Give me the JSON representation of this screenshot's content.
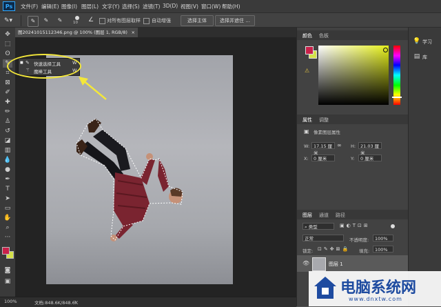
{
  "app": {
    "logo": "Ps"
  },
  "menu": [
    "文件(F)",
    "编辑(E)",
    "图像(I)",
    "图层(L)",
    "文字(Y)",
    "选择(S)",
    "滤镜(T)",
    "3D(D)",
    "视图(V)",
    "窗口(W)",
    "帮助(H)"
  ],
  "options_bar": {
    "brush_size": "10",
    "sample_all_layers": "对所有图层取样",
    "auto_enhance": "自动增强",
    "select_subject": "选择主体",
    "select_and_mask": "选择并遮住 ..."
  },
  "document": {
    "tab_title": "图20241015112346.png @ 100% (图层 1, RGB/8)",
    "close": "×"
  },
  "flyout": {
    "items": [
      {
        "label": "快速选择工具",
        "shortcut": "W"
      },
      {
        "label": "魔棒工具",
        "shortcut": "W"
      }
    ]
  },
  "status": {
    "zoom": "100%",
    "doc_info": "文档:848.6K/848.6K",
    "arrow": "›"
  },
  "color_panel": {
    "tabs": [
      "颜色",
      "色板"
    ],
    "foreground": "#c8214a",
    "background": "#d4e04a",
    "hue_color": "#e6f01a"
  },
  "properties_panel": {
    "tabs": [
      "属性",
      "调整"
    ],
    "title": "像素图层属性",
    "w_label": "W:",
    "w_value": "17.15 厘米",
    "h_label": "H:",
    "h_value": "21.03 厘米",
    "x_label": "X:",
    "x_value": "0 厘米",
    "y_label": "Y:",
    "y_value": "0 厘米"
  },
  "layers_panel": {
    "tabs": [
      "图层",
      "通道",
      "路径"
    ],
    "filter": "类型",
    "blend_mode": "正常",
    "opacity_label": "不透明度:",
    "opacity_value": "100%",
    "lock_label": "锁定:",
    "fill_label": "填充:",
    "fill_value": "100%",
    "layers": [
      {
        "name": "图层 1",
        "visible": true
      }
    ]
  },
  "right_strip": [
    {
      "icon": "lightbulb-icon",
      "label": "学习"
    },
    {
      "icon": "library-icon",
      "label": "库"
    }
  ],
  "watermark": {
    "text": "电脑系统网",
    "url": "www.dnxtw.com"
  }
}
